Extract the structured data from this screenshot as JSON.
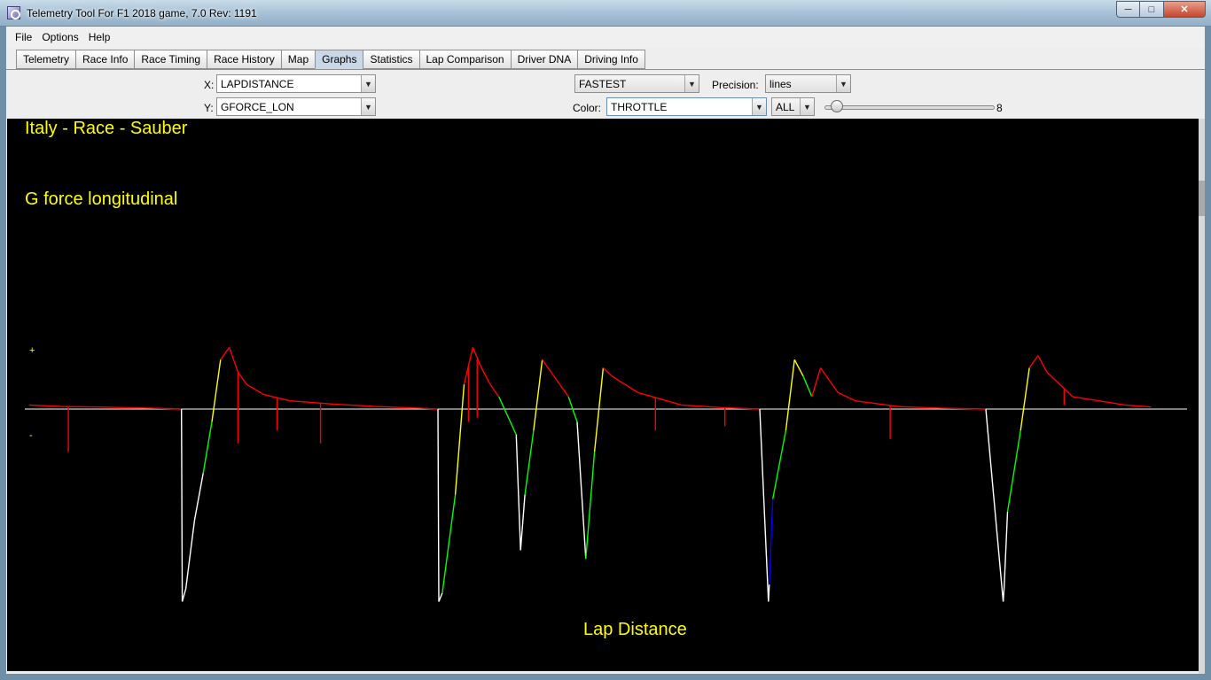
{
  "window": {
    "title": "Telemetry Tool For F1 2018 game, 7.0  Rev: 1191"
  },
  "menu": {
    "items": [
      "File",
      "Options",
      "Help"
    ]
  },
  "tabs": [
    "Telemetry",
    "Race Info",
    "Race Timing",
    "Race History",
    "Map",
    "Graphs",
    "Statistics",
    "Lap Comparison",
    "Driver DNA",
    "Driving Info"
  ],
  "active_tab": "Graphs",
  "controls": {
    "x_label": "X:",
    "x_value": "LAPDISTANCE",
    "y_label": "Y:",
    "y_value": "GFORCE_LON",
    "lap_value": "FASTEST",
    "precision_label": "Precision:",
    "precision_value": "lines",
    "color_label": "Color:",
    "color_value": "THROTTLE",
    "filter_value": "ALL",
    "slider_value": "8"
  },
  "chart": {
    "title": "Italy - Race - Sauber",
    "ylabel": "G force longitudinal",
    "xlabel": "Lap Distance",
    "plus": "+",
    "minus": "-"
  },
  "chart_data": {
    "type": "line",
    "title": "Italy - Race - Sauber",
    "ylabel": "G force longitudinal",
    "xlabel": "Lap Distance",
    "color_by": "THROTTLE",
    "grid": false,
    "colors": {
      "background": "#000000",
      "zero_line": "#ffffff",
      "full_throttle": "#ff0000",
      "high_throttle": "#ffff00",
      "mid_throttle": "#00ff00",
      "low": "#0000ff",
      "off": "#ffffff"
    },
    "series": [
      {
        "x": [
          0,
          40,
          80,
          120,
          160,
          175,
          176,
          180,
          190,
          200,
          210,
          220,
          230,
          240,
          250,
          270,
          300,
          350,
          400,
          450,
          470,
          471,
          475,
          490,
          500,
          510,
          520,
          530,
          540,
          560,
          565,
          570,
          580,
          590,
          600,
          610,
          620,
          630,
          640,
          650,
          660,
          670,
          700,
          750,
          800,
          840,
          850,
          851,
          855,
          870,
          880,
          890,
          900,
          910,
          920,
          930,
          950,
          1000,
          1050,
          1100,
          1120,
          1121,
          1125,
          1140,
          1150,
          1160,
          1170,
          1180,
          1190,
          1200,
          1230,
          1260,
          1290
        ],
        "y": [
          0.1,
          0.06,
          0.05,
          0.03,
          0.01,
          0.0,
          -4.5,
          -4.2,
          -2.6,
          -1.5,
          -0.3,
          1.2,
          1.5,
          0.9,
          0.6,
          0.35,
          0.2,
          0.12,
          0.06,
          0.02,
          0.0,
          -4.5,
          -4.3,
          -2.0,
          0.6,
          1.5,
          1.0,
          0.6,
          0.3,
          -0.6,
          -3.3,
          -2.0,
          -0.5,
          1.2,
          0.9,
          0.6,
          0.3,
          -0.3,
          -3.5,
          -1.0,
          1.0,
          0.8,
          0.4,
          0.1,
          0.03,
          0.0,
          -4.5,
          -4.1,
          -2.1,
          -0.5,
          1.2,
          0.8,
          0.3,
          1.0,
          0.7,
          0.4,
          0.2,
          0.06,
          0.02,
          0.0,
          -4.5,
          -4.2,
          -2.4,
          -0.5,
          1.0,
          1.3,
          0.9,
          0.7,
          0.5,
          0.3,
          0.2,
          0.1,
          0.05
        ],
        "throttle": [
          "full",
          "full",
          "full",
          "full",
          "full",
          "full",
          "off",
          "off",
          "off",
          "off",
          "mid",
          "high",
          "full",
          "full",
          "full",
          "full",
          "full",
          "full",
          "full",
          "full",
          "full",
          "off",
          "off",
          "mid",
          "high",
          "full",
          "full",
          "full",
          "full",
          "mid",
          "off",
          "off",
          "mid",
          "high",
          "full",
          "full",
          "full",
          "mid",
          "off",
          "mid",
          "high",
          "full",
          "full",
          "full",
          "full",
          "full",
          "off",
          "off",
          "low",
          "mid",
          "high",
          "high",
          "mid",
          "full",
          "full",
          "full",
          "full",
          "full",
          "full",
          "full",
          "off",
          "off",
          "off",
          "mid",
          "high",
          "full",
          "full",
          "full",
          "full",
          "full",
          "full",
          "full",
          "full"
        ]
      }
    ],
    "ylim": [
      -4.8,
      2.0
    ],
    "xlim": [
      0,
      1310
    ],
    "spikes": [
      {
        "x": 45,
        "y": -1.0
      },
      {
        "x": 240,
        "y": -0.8
      },
      {
        "x": 285,
        "y": -0.5
      },
      {
        "x": 335,
        "y": -0.8
      },
      {
        "x": 505,
        "y": -0.3
      },
      {
        "x": 515,
        "y": -0.2
      },
      {
        "x": 720,
        "y": -0.5
      },
      {
        "x": 800,
        "y": -0.4
      },
      {
        "x": 990,
        "y": -0.7
      },
      {
        "x": 1190,
        "y": 0.1
      },
      {
        "x": 1255,
        "y": 0.1
      }
    ]
  }
}
